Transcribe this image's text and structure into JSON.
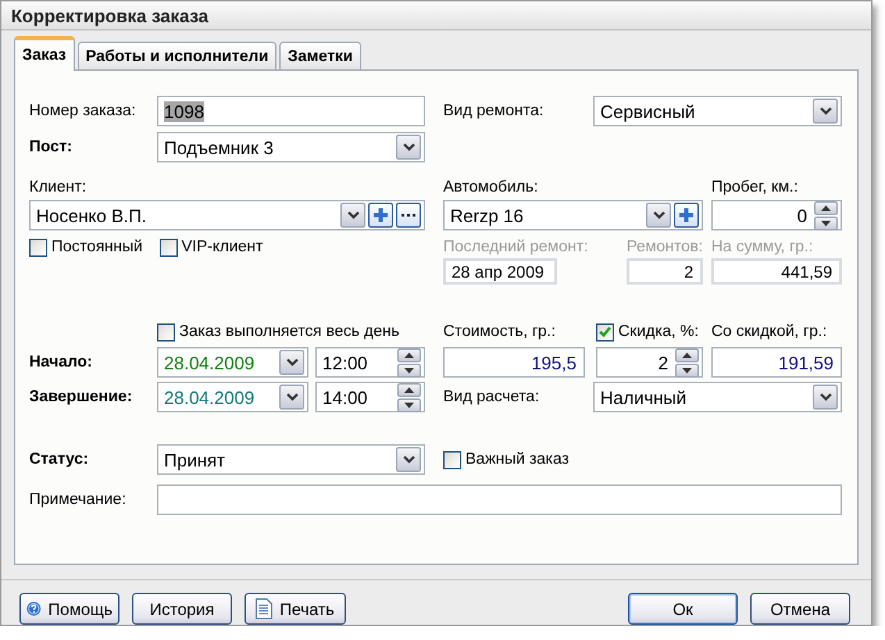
{
  "window": {
    "title": "Корректировка заказа"
  },
  "tabs": [
    {
      "label": "Заказ",
      "selected": true
    },
    {
      "label": "Работы и исполнители",
      "selected": false
    },
    {
      "label": "Заметки",
      "selected": false
    }
  ],
  "order_number": {
    "label": "Номер заказа:",
    "value": "1098",
    "highlighted": true
  },
  "repair_type": {
    "label": "Вид ремонта:",
    "value": "Сервисный"
  },
  "post": {
    "label": "Пост:",
    "value": "Подъемник 3"
  },
  "client": {
    "label": "Клиент:",
    "value": "Носенко В.П."
  },
  "client_flags": [
    {
      "label": "Постоянный",
      "checked": false
    },
    {
      "label": "VIP-клиент",
      "checked": false
    }
  ],
  "car": {
    "label": "Автомобиль:",
    "value": "Rerzp 16"
  },
  "mileage": {
    "label": "Пробег, км.:",
    "value": "0"
  },
  "history": [
    {
      "label": "Последний ремонт:",
      "value": "28 апр 2009"
    },
    {
      "label": "Ремонтов:",
      "value": "2"
    },
    {
      "label": "На сумму, гр.:",
      "value": "441,59"
    }
  ],
  "all_day": {
    "label": "Заказ выполняется весь день",
    "checked": false
  },
  "start": {
    "label": "Начало:",
    "date": "28.04.2009",
    "time": "12:00"
  },
  "end": {
    "label": "Завершение:",
    "date": "28.04.2009",
    "time": "14:00"
  },
  "cost": {
    "label": "Стоимость, гр.:",
    "value": "195,5"
  },
  "discount": {
    "label": "Скидка, %:",
    "checked": true,
    "value": "2"
  },
  "discounted": {
    "label": "Со скидкой, гр.:",
    "value": "191,59"
  },
  "payment": {
    "label": "Вид расчета:",
    "value": "Наличный"
  },
  "status": {
    "label": "Статус:",
    "value": "Принят"
  },
  "important": {
    "label": "Важный заказ",
    "checked": false
  },
  "note": {
    "label": "Примечание:"
  },
  "buttons": [
    {
      "label": "Помощь",
      "kind": "help"
    },
    {
      "label": "История",
      "kind": "plain"
    },
    {
      "label": "Печать",
      "kind": "print"
    },
    {
      "label": "Ок",
      "kind": "default"
    },
    {
      "label": "Отмена",
      "kind": "plain"
    }
  ]
}
